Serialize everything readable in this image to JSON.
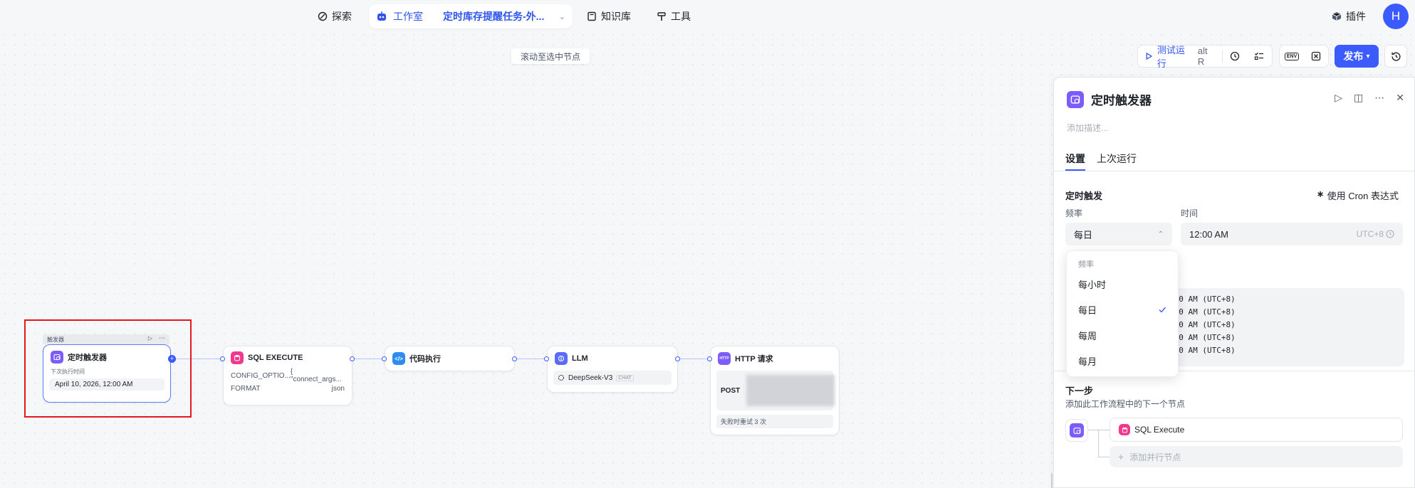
{
  "nav": {
    "explore": "探索",
    "studio": "工作室",
    "workflow_name": "定时库存提醒任务-外...",
    "knowledge": "知识库",
    "tools": "工具",
    "plugins": "插件",
    "avatar": "H"
  },
  "canvas": {
    "scroll_hint": "滚动至选中节点"
  },
  "toolbar": {
    "test_run": "测试运行",
    "shortcut": "alt  R",
    "env": "ENV",
    "publish": "发布"
  },
  "nodes": {
    "trigger": {
      "group_label": "触发器",
      "title": "定时触发器",
      "next_label": "下次执行时间",
      "next_time": "April 10, 2026, 12:00 AM"
    },
    "sql": {
      "title": "SQL EXECUTE",
      "rows": [
        {
          "k": "CONFIG_OPTIO...",
          "v": "{ \"connect_args..."
        },
        {
          "k": "FORMAT",
          "v": "json"
        }
      ]
    },
    "code": {
      "title": "代码执行"
    },
    "llm": {
      "title": "LLM",
      "model": "DeepSeek-V3",
      "badge": "CHAT"
    },
    "http": {
      "title": "HTTP 请求",
      "method": "POST",
      "retry": "失败时重试 3 次"
    }
  },
  "panel": {
    "title": "定时触发器",
    "desc_placeholder": "添加描述...",
    "tabs": [
      "设置",
      "上次运行"
    ],
    "trigger_section": "定时触发",
    "cron_link": "使用 Cron 表达式",
    "freq_label": "频率",
    "time_label": "时间",
    "freq_value": "每日",
    "time_value": "12:00 AM",
    "tz": "UTC+8",
    "preview_lines": [
      ":00 AM (UTC+8)",
      ":00 AM (UTC+8)",
      ":00 AM (UTC+8)",
      ":00 AM (UTC+8)",
      ":00 AM (UTC+8)"
    ],
    "next_step_title": "下一步",
    "next_step_desc": "添加此工作流程中的下一个节点",
    "next_node": "SQL Execute",
    "add_parallel": "添加并行节点"
  },
  "dropdown": {
    "header": "频率",
    "options": [
      "每小时",
      "每日",
      "每周",
      "每月"
    ],
    "selected": "每日"
  },
  "colors": {
    "accent": "#3b5bff",
    "trigger_icon": "#7c5cfc",
    "sql_icon": "#f0388c",
    "code_icon": "#2e8cf0",
    "llm_icon": "#5b6bf5",
    "http_icon": "#7c5cfc",
    "highlight_box": "#e5161c"
  }
}
